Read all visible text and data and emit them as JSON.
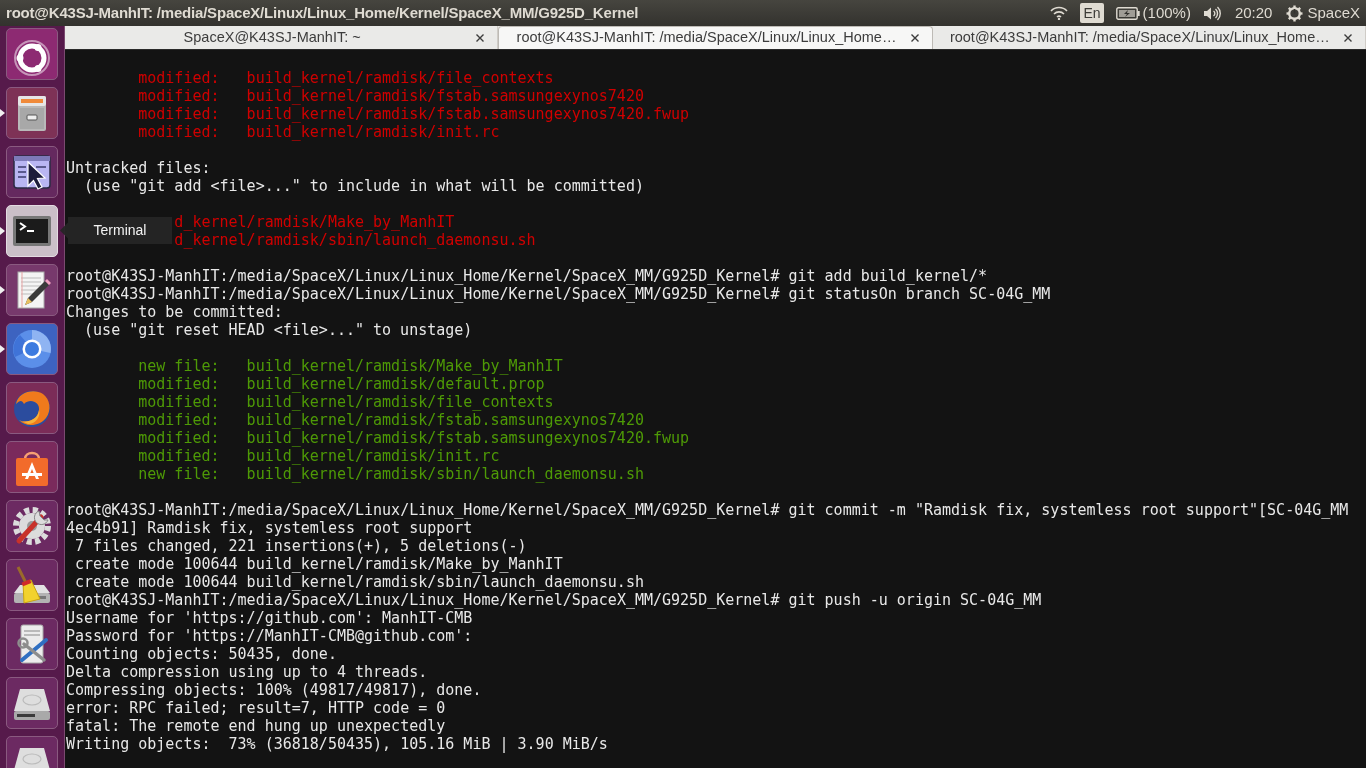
{
  "top_panel": {
    "title": "root@K43SJ-ManhIT: /media/SpaceX/Linux/Linux_Home/Kernel/SpaceX_MM/G925D_Kernel",
    "keyboard_layout": "En",
    "battery": "(100%)",
    "clock": "20:20",
    "user": "SpaceX"
  },
  "launcher": {
    "items": [
      {
        "kind": "dash",
        "running": false,
        "highlighted": false
      },
      {
        "kind": "files",
        "running": true,
        "highlighted": false
      },
      {
        "kind": "pointer",
        "running": false,
        "highlighted": false
      },
      {
        "kind": "terminal",
        "running": true,
        "highlighted": true,
        "tooltip": "Terminal"
      },
      {
        "kind": "editor",
        "running": true,
        "highlighted": false
      },
      {
        "kind": "chromium",
        "running": true,
        "highlighted": false
      },
      {
        "kind": "firefox",
        "running": false,
        "highlighted": false
      },
      {
        "kind": "store",
        "running": false,
        "highlighted": false
      },
      {
        "kind": "settings",
        "running": false,
        "highlighted": false
      },
      {
        "kind": "cleaner",
        "running": false,
        "highlighted": false
      },
      {
        "kind": "tools",
        "running": false,
        "highlighted": false
      },
      {
        "kind": "disk",
        "running": false,
        "highlighted": false
      },
      {
        "kind": "disk",
        "running": false,
        "highlighted": false
      }
    ]
  },
  "terminal": {
    "tabs": [
      {
        "label": "SpaceX@K43SJ-ManhIT: ~",
        "selected": false
      },
      {
        "label": "root@K43SJ-ManhIT: /media/SpaceX/Linux/Linux_Home…",
        "selected": true
      },
      {
        "label": "root@K43SJ-ManhIT: /media/SpaceX/Linux/Linux_Home…",
        "selected": false
      }
    ],
    "lines": [
      {
        "kind": "unstaged",
        "text": "modified:   build_kernel/ramdisk/file_contexts"
      },
      {
        "kind": "unstaged",
        "text": "modified:   build_kernel/ramdisk/fstab.samsungexynos7420"
      },
      {
        "kind": "unstaged",
        "text": "modified:   build_kernel/ramdisk/fstab.samsungexynos7420.fwup"
      },
      {
        "kind": "unstaged",
        "text": "modified:   build_kernel/ramdisk/init.rc"
      },
      {
        "kind": "blank"
      },
      {
        "kind": "plain",
        "text": "Untracked files:"
      },
      {
        "kind": "hint",
        "text": "(use \"git add <file>...\" to include in what will be committed)"
      },
      {
        "kind": "blank"
      },
      {
        "kind": "untracked",
        "text": "d_kernel/ramdisk/Make_by_ManhIT"
      },
      {
        "kind": "untracked",
        "text": "d_kernel/ramdisk/sbin/launch_daemonsu.sh"
      },
      {
        "kind": "blank"
      },
      {
        "kind": "plain",
        "text": "root@K43SJ-ManhIT:/media/SpaceX/Linux/Linux_Home/Kernel/SpaceX_MM/G925D_Kernel# git add build_kernel/*"
      },
      {
        "kind": "plain",
        "text": "root@K43SJ-ManhIT:/media/SpaceX/Linux/Linux_Home/Kernel/SpaceX_MM/G925D_Kernel# git statusOn branch SC-04G_MM"
      },
      {
        "kind": "plain",
        "text": "Changes to be committed:"
      },
      {
        "kind": "hint",
        "text": "(use \"git reset HEAD <file>...\" to unstage)"
      },
      {
        "kind": "blank"
      },
      {
        "kind": "staged",
        "text": "new file:   build_kernel/ramdisk/Make_by_ManhIT"
      },
      {
        "kind": "staged",
        "text": "modified:   build_kernel/ramdisk/default.prop"
      },
      {
        "kind": "staged",
        "text": "modified:   build_kernel/ramdisk/file_contexts"
      },
      {
        "kind": "staged",
        "text": "modified:   build_kernel/ramdisk/fstab.samsungexynos7420"
      },
      {
        "kind": "staged",
        "text": "modified:   build_kernel/ramdisk/fstab.samsungexynos7420.fwup"
      },
      {
        "kind": "staged",
        "text": "modified:   build_kernel/ramdisk/init.rc"
      },
      {
        "kind": "staged",
        "text": "new file:   build_kernel/ramdisk/sbin/launch_daemonsu.sh"
      },
      {
        "kind": "blank"
      },
      {
        "kind": "plain",
        "text": "root@K43SJ-ManhIT:/media/SpaceX/Linux/Linux_Home/Kernel/SpaceX_MM/G925D_Kernel# git commit -m \"Ramdisk fix, systemless root support\"[SC-04G_MM"
      },
      {
        "kind": "plain",
        "text": "4ec4b91] Ramdisk fix, systemless root support"
      },
      {
        "kind": "summary",
        "text": "7 files changed, 221 insertions(+), 5 deletions(-)"
      },
      {
        "kind": "summary",
        "text": "create mode 100644 build_kernel/ramdisk/Make_by_ManhIT"
      },
      {
        "kind": "summary",
        "text": "create mode 100644 build_kernel/ramdisk/sbin/launch_daemonsu.sh"
      },
      {
        "kind": "plain",
        "text": "root@K43SJ-ManhIT:/media/SpaceX/Linux/Linux_Home/Kernel/SpaceX_MM/G925D_Kernel# git push -u origin SC-04G_MM"
      },
      {
        "kind": "plain",
        "text": "Username for 'https://github.com': ManhIT-CMB"
      },
      {
        "kind": "plain",
        "text": "Password for 'https://ManhIT-CMB@github.com':"
      },
      {
        "kind": "plain",
        "text": "Counting objects: 50435, done."
      },
      {
        "kind": "plain",
        "text": "Delta compression using up to 4 threads."
      },
      {
        "kind": "plain",
        "text": "Compressing objects: 100% (49817/49817), done."
      },
      {
        "kind": "plain",
        "text": "error: RPC failed; result=7, HTTP code = 0"
      },
      {
        "kind": "plain",
        "text": "fatal: The remote end hung up unexpectedly"
      },
      {
        "kind": "plain",
        "text": "Writing objects:  73% (36818/50435), 105.16 MiB | 3.90 MiB/s"
      }
    ]
  }
}
